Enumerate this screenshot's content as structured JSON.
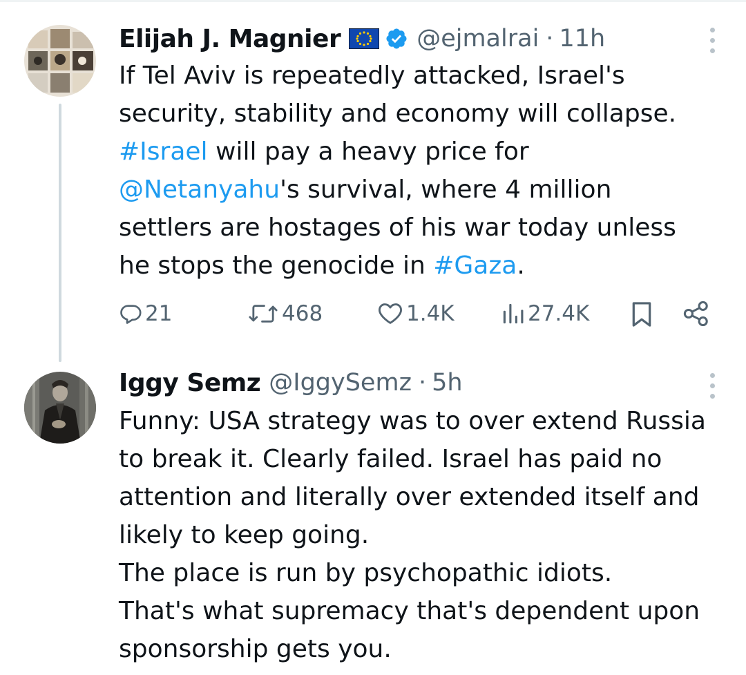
{
  "tweet1": {
    "author_name": "Elijah J. Magnier",
    "flag_icon": "eu-flag-icon",
    "verified_icon": "verified-badge-icon",
    "handle": "@ejmalrai",
    "separator": "·",
    "time": "11h",
    "text_segments": [
      [
        {
          "t": "If Tel Aviv is repeatedly attacked, Israel's"
        }
      ],
      [
        {
          "t": "security, stability and economy will collapse."
        }
      ],
      [
        {
          "t": "#Israel",
          "link": true
        },
        {
          "t": " will pay a heavy price for"
        }
      ],
      [
        {
          "t": "@Netanyahu",
          "link": true
        },
        {
          "t": "'s survival, where 4 million"
        }
      ],
      [
        {
          "t": "settlers are hostages of his war today unless"
        }
      ],
      [
        {
          "t": "he stops the genocide in "
        },
        {
          "t": "#Gaza",
          "link": true
        },
        {
          "t": "."
        }
      ]
    ],
    "stats": {
      "replies": "21",
      "retweets": "468",
      "likes": "1.4K",
      "views": "27.4K"
    }
  },
  "tweet2": {
    "author_name": "Iggy Semz",
    "handle": "@IggySemz",
    "separator": "·",
    "time": "5h",
    "text_lines": [
      "Funny: USA strategy was to over extend Russia",
      "to break it. Clearly failed. Israel has paid no",
      "attention and literally over extended itself and",
      "likely to keep going.",
      "The place is run by psychopathic idiots.",
      "That's what supremacy that's dependent upon",
      "sponsorship gets you."
    ]
  },
  "colors": {
    "link": "#1d9bf0",
    "secondary_text": "#536471",
    "primary_text": "#0f1419",
    "thread_line": "#cfd9de"
  }
}
